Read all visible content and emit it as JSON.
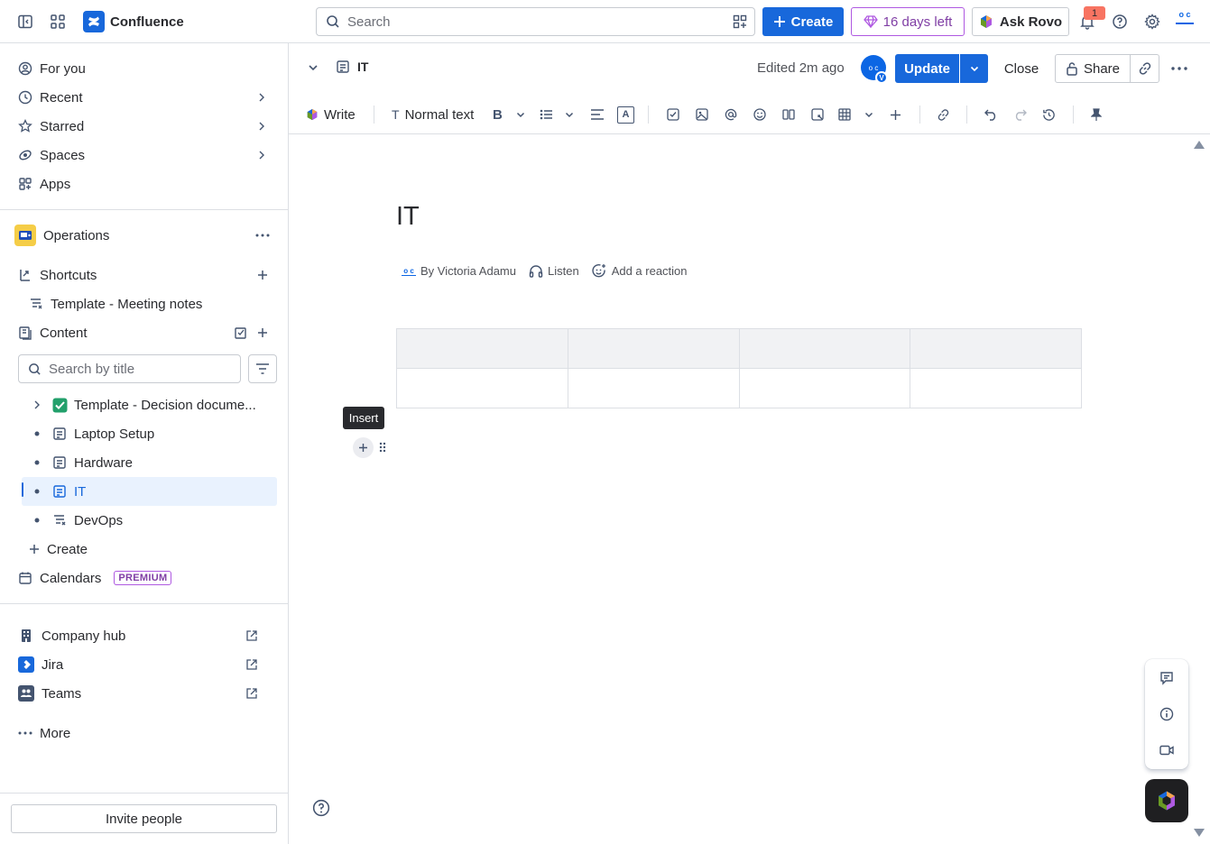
{
  "topbar": {
    "app_name": "Confluence",
    "search_placeholder": "Search",
    "create_label": "Create",
    "trial_label": "16 days left",
    "rovo_label": "Ask Rovo",
    "notification_count": "1",
    "avatar_initials_top": "o c",
    "avatar_initials_bottom": "",
    "icons": [
      "sidebar-toggle-icon",
      "app-switcher-icon",
      "search-icon",
      "apps-grid-icon",
      "plus-icon",
      "diamond-icon",
      "rovo-icon",
      "bell-icon",
      "help-icon",
      "gear-icon"
    ]
  },
  "sidebar": {
    "primary": [
      {
        "label": "For you",
        "icon": "user-circle-icon"
      },
      {
        "label": "Recent",
        "icon": "clock-icon"
      },
      {
        "label": "Starred",
        "icon": "star-icon"
      },
      {
        "label": "Spaces",
        "icon": "spaces-icon"
      },
      {
        "label": "Apps",
        "icon": "apps-icon"
      }
    ],
    "space_name": "Operations",
    "shortcuts_label": "Shortcuts",
    "shortcut_item": "Template - Meeting notes",
    "content_label": "Content",
    "title_search_placeholder": "Search by title",
    "tree": [
      {
        "label": "Template - Decision docume..."
      },
      {
        "label": "Laptop Setup"
      },
      {
        "label": "Hardware"
      },
      {
        "label": "IT"
      },
      {
        "label": "DevOps"
      }
    ],
    "create_label": "Create",
    "calendars_label": "Calendars",
    "premium_badge": "PREMIUM",
    "apps": [
      {
        "label": "Company hub"
      },
      {
        "label": "Jira"
      },
      {
        "label": "Teams"
      }
    ],
    "more_label": "More",
    "invite_label": "Invite people"
  },
  "page_header": {
    "title": "IT",
    "edited_label": "Edited 2m ago",
    "collaborator_initials": "o c",
    "collaborator_badge": "V",
    "update_label": "Update",
    "close_label": "Close",
    "share_label": "Share"
  },
  "toolbar": {
    "write_label": "Write",
    "text_style_label": "Normal text",
    "text_style_icon_glyph": "T",
    "bold_glyph": "B",
    "text_color_glyph": "A"
  },
  "editor": {
    "title": "IT",
    "author_avatar_initials": "o c",
    "author_label": "By Victoria Adamu",
    "listen_label": "Listen",
    "reaction_label": "Add a reaction",
    "table": {
      "rows": 2,
      "cols": 4
    },
    "tooltip_label": "Insert"
  },
  "colors": {
    "brand": "#1868db",
    "trial_purple": "#803fa5",
    "selected_bg": "#e9f2fe",
    "border": "#dcdfe4"
  }
}
